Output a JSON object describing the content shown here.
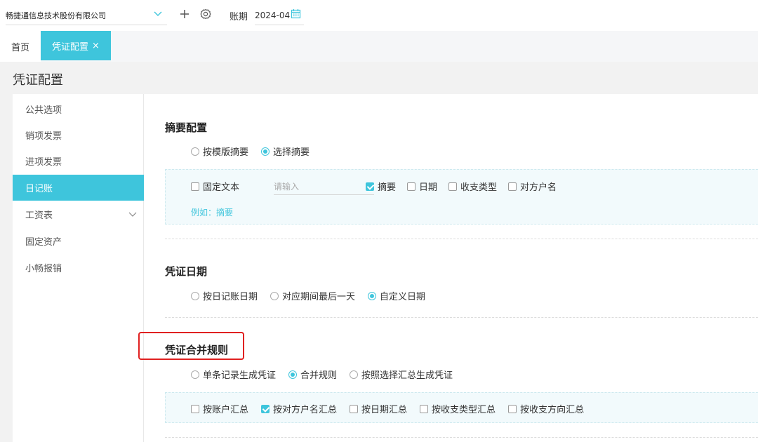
{
  "topbar": {
    "company": "畅捷通信息技术股份有限公司",
    "period_label": "账期",
    "period_value": "2024-04"
  },
  "tabs": {
    "home": "首页",
    "active": "凭证配置",
    "close": "×"
  },
  "page": {
    "title": "凭证配置"
  },
  "sidebar": {
    "items": [
      {
        "label": "公共选项"
      },
      {
        "label": "销项发票"
      },
      {
        "label": "进项发票"
      },
      {
        "label": "日记账"
      },
      {
        "label": "工资表"
      },
      {
        "label": "固定资产"
      },
      {
        "label": "小畅报销"
      }
    ]
  },
  "summary": {
    "title": "摘要配置",
    "options": [
      {
        "label": "按模版摘要",
        "selected": false
      },
      {
        "label": "选择摘要",
        "selected": true
      }
    ],
    "fixed_text_label": "固定文本",
    "fixed_text_placeholder": "请输入",
    "checks": [
      {
        "label": "摘要",
        "checked": true
      },
      {
        "label": "日期",
        "checked": false
      },
      {
        "label": "收支类型",
        "checked": false
      },
      {
        "label": "对方户名",
        "checked": false
      }
    ],
    "example": "例如：摘要"
  },
  "voucher_date": {
    "title": "凭证日期",
    "options": [
      {
        "label": "按日记账日期",
        "selected": false
      },
      {
        "label": "对应期间最后一天",
        "selected": false
      },
      {
        "label": "自定义日期",
        "selected": true
      }
    ]
  },
  "merge_rule": {
    "title": "凭证合并规则",
    "options": [
      {
        "label": "单条记录生成凭证",
        "selected": false
      },
      {
        "label": "合并规则",
        "selected": true
      },
      {
        "label": "按照选择汇总生成凭证",
        "selected": false
      }
    ],
    "checks": [
      {
        "label": "按账户汇总",
        "checked": false
      },
      {
        "label": "按对方户名汇总",
        "checked": true
      },
      {
        "label": "按日期汇总",
        "checked": false
      },
      {
        "label": "按收支类型汇总",
        "checked": false
      },
      {
        "label": "按收支方向汇总",
        "checked": false
      }
    ]
  },
  "colors": {
    "accent": "#3ec5dc",
    "highlight": "#e02020"
  }
}
